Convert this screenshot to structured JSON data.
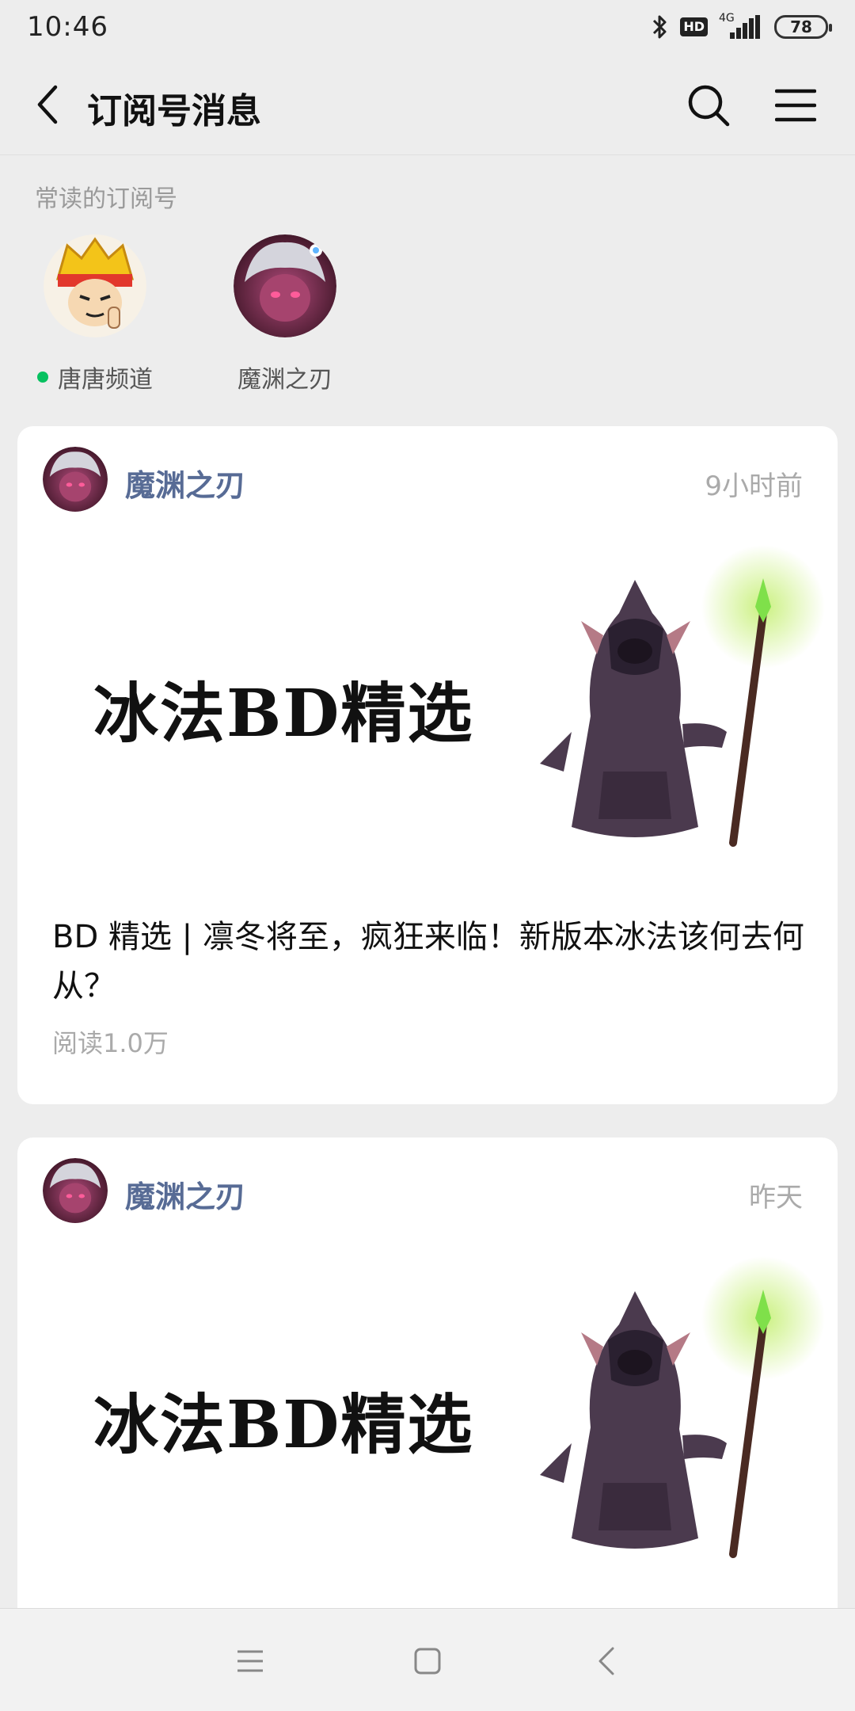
{
  "status": {
    "time": "10:46",
    "network": "4G",
    "hd": "HD",
    "battery": "78"
  },
  "header": {
    "title": "订阅号消息",
    "back_icon": "chevron-left-icon",
    "search_icon": "search-icon",
    "menu_icon": "menu-icon"
  },
  "frequent": {
    "label": "常读的订阅号",
    "items": [
      {
        "name": "唐唐频道",
        "online": true
      },
      {
        "name": "魔渊之刃",
        "online": false
      }
    ]
  },
  "articles": [
    {
      "author": "魔渊之刃",
      "time": "9小时前",
      "cover_text": "冰法BD精选",
      "title": "BD 精选 | 凛冬将至，疯狂来临！新版本冰法该何去何从？",
      "reads": "阅读1.0万"
    },
    {
      "author": "魔渊之刃",
      "time": "昨天",
      "cover_text": "冰法BD精选",
      "title": "",
      "reads": ""
    }
  ],
  "colors": {
    "background": "#ededed",
    "card": "#ffffff",
    "author_link": "#576b95",
    "online_dot": "#07c160",
    "muted_text": "#aaaaaa"
  },
  "navbar": {
    "icons": [
      "recent-apps-icon",
      "home-icon",
      "back-icon"
    ]
  }
}
